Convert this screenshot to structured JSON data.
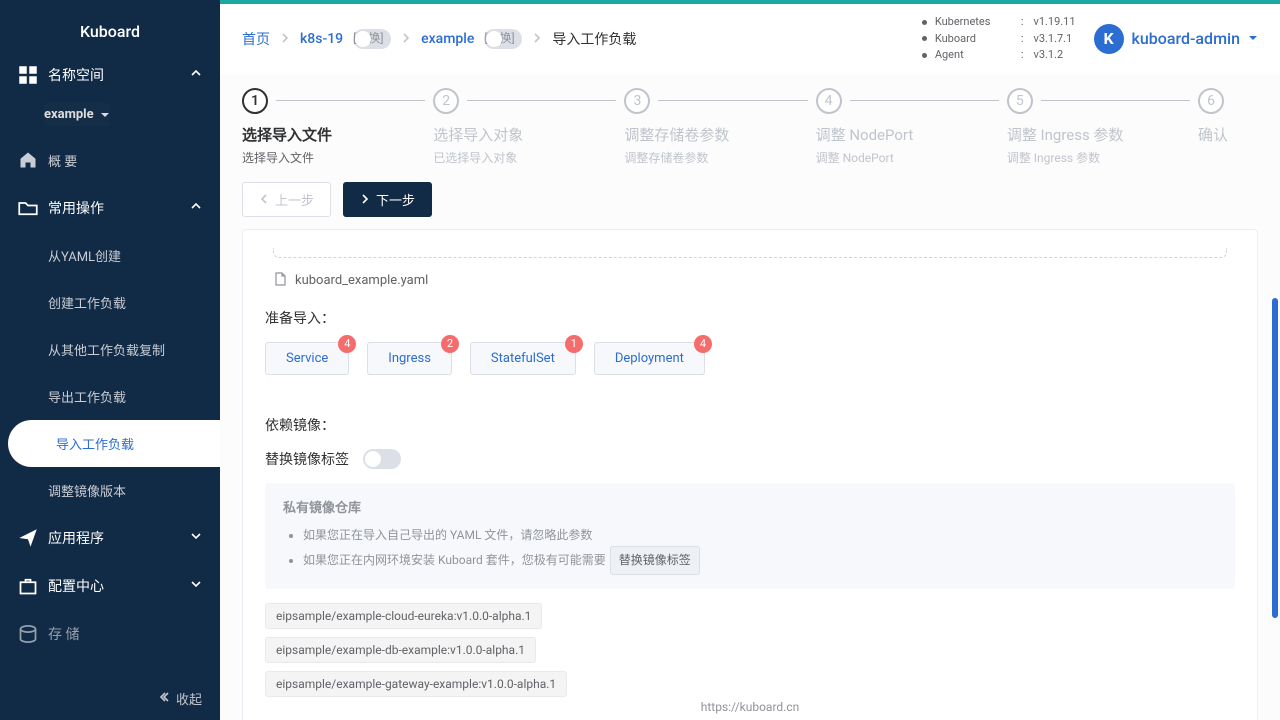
{
  "logo": "Kuboard",
  "sidebar": {
    "namespace_group": "名称空间",
    "namespace": "example",
    "overview": "概 要",
    "common_ops": "常用操作",
    "items": {
      "yaml_create": "从YAML创建",
      "create_workload": "创建工作负载",
      "copy_workload": "从其他工作负载复制",
      "export_workload": "导出工作负载",
      "import_workload": "导入工作负载",
      "adjust_image": "调整镜像版本"
    },
    "apps": "应用程序",
    "config_center": "配置中心",
    "storage": "存 储",
    "collapse": "收起"
  },
  "breadcrumb": {
    "home": "首页",
    "cluster": "k8s-19",
    "switch": "[切换]",
    "ns": "example",
    "current": "导入工作负载"
  },
  "versions": {
    "k8s_label": "Kubernetes",
    "k8s_val": "v1.19.11",
    "kb_label": "Kuboard",
    "kb_val": "v3.1.7.1",
    "ag_label": "Agent",
    "ag_val": "v3.1.2"
  },
  "user": {
    "initial": "K",
    "name": "kuboard-admin"
  },
  "steps": [
    {
      "title": "选择导入文件",
      "desc": "选择导入文件"
    },
    {
      "title": "选择导入对象",
      "desc": "已选择导入对象"
    },
    {
      "title": "调整存储卷参数",
      "desc": "调整存储卷参数"
    },
    {
      "title": "调整 NodePort",
      "desc": "调整 NodePort"
    },
    {
      "title": "调整 Ingress 参数",
      "desc": "调整 Ingress 参数"
    },
    {
      "title": "确认",
      "desc": ""
    }
  ],
  "buttons": {
    "prev": "上一步",
    "next": "下一步"
  },
  "file_name": "kuboard_example.yaml",
  "prepare_label": "准备导入：",
  "tags": [
    {
      "label": "Service",
      "count": "4"
    },
    {
      "label": "Ingress",
      "count": "2"
    },
    {
      "label": "StatefulSet",
      "count": "1"
    },
    {
      "label": "Deployment",
      "count": "4"
    }
  ],
  "depend_label": "依赖镜像：",
  "replace_label": "替换镜像标签",
  "info": {
    "title": "私有镜像仓库",
    "line1": "如果您正在导入自己导出的 YAML 文件，请忽略此参数",
    "line2_a": "如果您正在内网环境安装 Kuboard 套件，您极有可能需要",
    "line2_tag": "替换镜像标签"
  },
  "images": [
    "eipsample/example-cloud-eureka:v1.0.0-alpha.1",
    "eipsample/example-db-example:v1.0.0-alpha.1",
    "eipsample/example-gateway-example:v1.0.0-alpha.1"
  ],
  "footer": "https://kuboard.cn"
}
